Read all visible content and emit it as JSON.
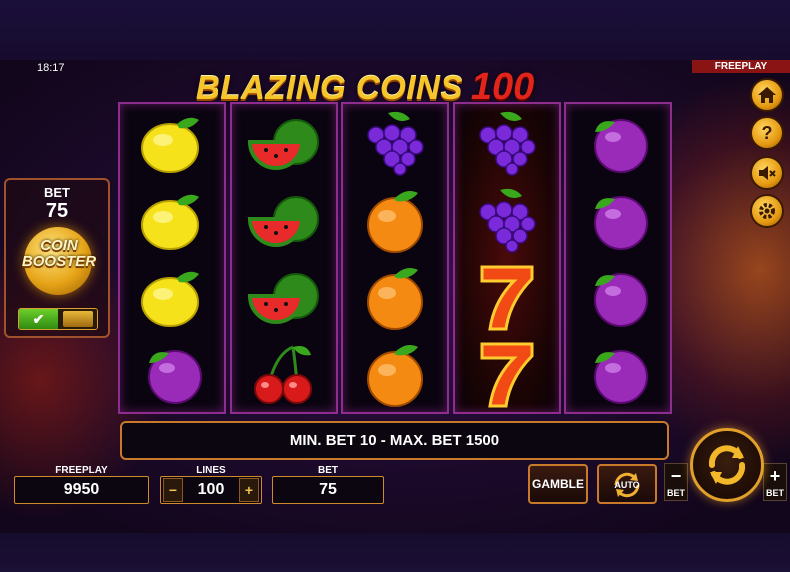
{
  "status": {
    "time": "18:17",
    "mode_tag": "FREEPLAY"
  },
  "game": {
    "title": "BLAZING COINS",
    "title_number": "100"
  },
  "reels": [
    [
      "lemon",
      "lemon",
      "lemon",
      "plum"
    ],
    [
      "watermelon",
      "watermelon",
      "watermelon",
      "cherry"
    ],
    [
      "grapes",
      "orange",
      "orange",
      "orange"
    ],
    [
      "grapes",
      "grapes",
      "seven",
      "seven"
    ],
    [
      "plum",
      "plum",
      "plum",
      "plum"
    ]
  ],
  "coin_booster": {
    "bet_label": "BET",
    "bet_value": "75",
    "label": "COIN BOOSTER",
    "enabled_mark": "✔"
  },
  "side_menu": [
    {
      "name": "home-icon"
    },
    {
      "name": "help-icon",
      "glyph": "?"
    },
    {
      "name": "sound-off-icon"
    },
    {
      "name": "settings-icon"
    }
  ],
  "info": {
    "message": "MIN. BET 10 - MAX. BET 1500"
  },
  "controls": {
    "freeplay_label": "FREEPLAY",
    "freeplay_value": "9950",
    "lines_label": "LINES",
    "lines_value": "100",
    "lines_minus": "−",
    "lines_plus": "+",
    "bet_label": "BET",
    "bet_value": "75",
    "gamble_label": "GAMBLE",
    "auto_label": "AUTO",
    "bet_minus_symbol": "−",
    "bet_minus_caption": "BET",
    "bet_plus_symbol": "+",
    "bet_plus_caption": "BET"
  },
  "colors": {
    "accent": "#e0a02a",
    "reel_border": "#8e2d8e",
    "title_gold": "#f6c52a",
    "title_red": "#e2241a"
  }
}
